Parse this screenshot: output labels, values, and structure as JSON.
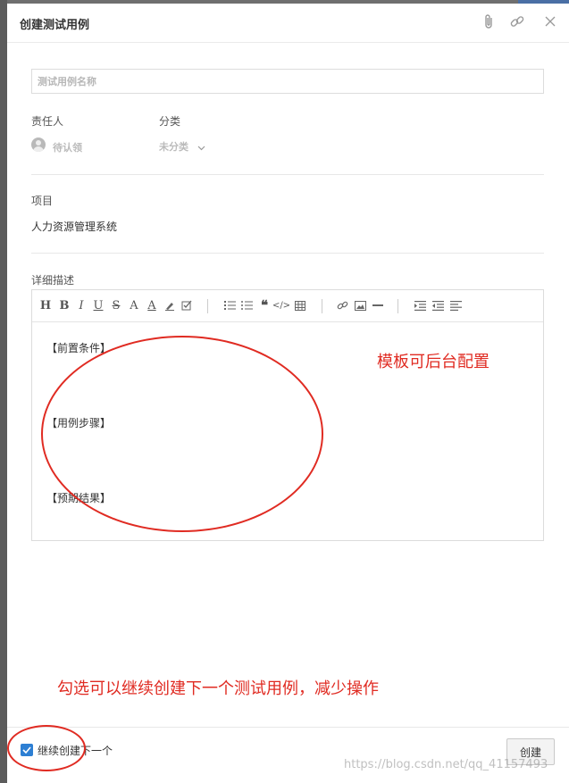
{
  "dialog": {
    "title": "创建测试用例"
  },
  "form": {
    "name_placeholder": "测试用例名称",
    "owner_label": "责任人",
    "owner_value": "待认领",
    "category_label": "分类",
    "category_value": "未分类",
    "project_label": "项目",
    "project_value": "人力资源管理系统",
    "description_label": "详细描述"
  },
  "editor": {
    "template_lines": [
      "【前置条件】",
      "【用例步骤】",
      "【预期结果】"
    ]
  },
  "annotations": {
    "template_note": "模板可后台配置",
    "continue_note": "勾选可以继续创建下一个测试用例，减少操作"
  },
  "footer": {
    "continue_label": "继续创建下一个",
    "continue_checked": true,
    "create_button": "创建"
  },
  "watermark": "https://blog.csdn.net/qq_41157493",
  "colors": {
    "annotation": "#e02b22",
    "checkbox": "#2d7fd3"
  }
}
